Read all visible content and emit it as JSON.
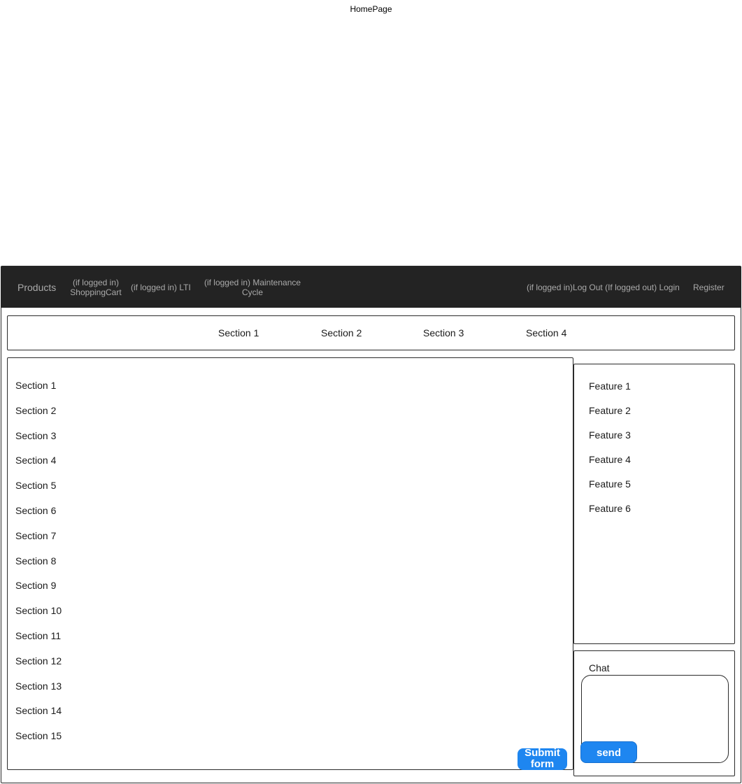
{
  "page": {
    "title": "HomePage"
  },
  "navbar": {
    "products": "Products",
    "cart_line1": "(if logged in)",
    "cart_line2": "ShoppingCart",
    "lti": "(if logged in) LTI",
    "maintenance_line1": "(if logged in) Maintenance",
    "maintenance_line2": "Cycle",
    "logout_login": "(if logged in)Log Out (If logged out) Login",
    "register": "Register",
    "colors": {
      "background": "#232323",
      "text": "#aaaaaa"
    }
  },
  "tabs": [
    {
      "label": "Section 1"
    },
    {
      "label": "Section 2"
    },
    {
      "label": "Section 3"
    },
    {
      "label": "Section 4"
    }
  ],
  "main": {
    "sections": [
      "Section 1",
      "Section 2",
      "Section 3",
      "Section 4",
      "Section 5",
      "Section 6",
      "Section 7",
      "Section 8",
      "Section 9",
      "Section 10",
      "Section 11",
      "Section 12",
      "Section 13",
      "Section 14",
      "Section 15"
    ],
    "submit_line1": "Submit",
    "submit_line2": "form"
  },
  "features": [
    "Feature 1",
    "Feature 2",
    "Feature 3",
    "Feature 4",
    "Feature 5",
    "Feature 6"
  ],
  "chat": {
    "label": "Chat",
    "send_label": "send"
  },
  "colors": {
    "button_primary": "#1e86f0"
  }
}
